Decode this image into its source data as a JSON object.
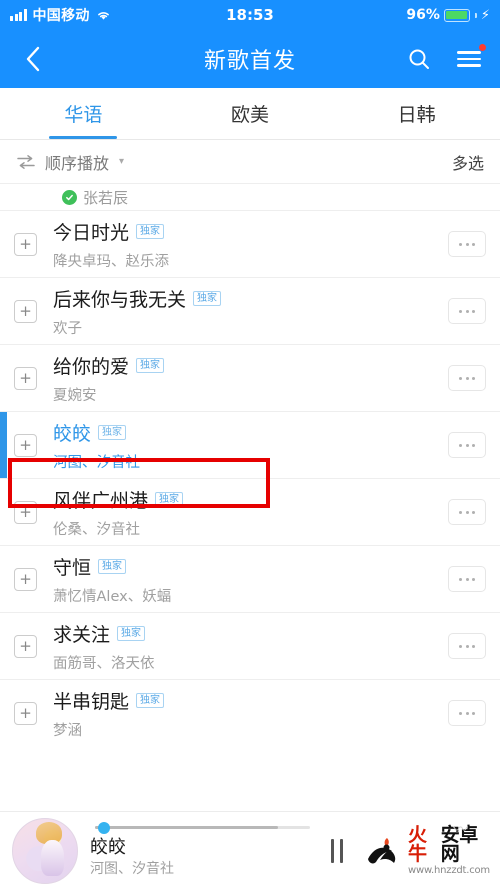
{
  "status_bar": {
    "carrier": "中国移动",
    "time": "18:53",
    "battery_percent": "96%",
    "battery_level": 96,
    "charging_icon": "⚡",
    "signal_icon": "signal-bars-icon",
    "wifi_icon": "wifi-icon"
  },
  "header": {
    "title": "新歌首发",
    "back_icon": "back-chevron-icon",
    "search_icon": "search-icon",
    "menu_icon": "hamburger-menu-icon",
    "notification_dot": true,
    "background_color": "#1890ff"
  },
  "tabs": [
    {
      "label": "华语",
      "active": true
    },
    {
      "label": "欧美",
      "active": false
    },
    {
      "label": "日韩",
      "active": false
    }
  ],
  "control_row": {
    "play_mode_icon": "sequential-play-icon",
    "play_mode_label": "顺序播放",
    "chevron_icon": "chevron-down-icon",
    "multi_select_label": "多选"
  },
  "partial_row": {
    "verified_icon": "verified-badge-icon",
    "artist": "张若辰"
  },
  "songs": [
    {
      "title": "今日时光",
      "badge": "独家",
      "artist": "降央卓玛、赵乐添",
      "playing": false,
      "add_icon": "plus-icon",
      "more_icon": "more-dots-icon"
    },
    {
      "title": "后来你与我无关",
      "badge": "独家",
      "artist": "欢子",
      "playing": false,
      "add_icon": "plus-icon",
      "more_icon": "more-dots-icon"
    },
    {
      "title": "给你的爱",
      "badge": "独家",
      "artist": "夏婉安",
      "playing": false,
      "add_icon": "plus-icon",
      "more_icon": "more-dots-icon"
    },
    {
      "title": "皎皎",
      "badge": "独家",
      "artist": "河图、汐音社",
      "playing": true,
      "add_icon": "plus-icon",
      "more_icon": "more-dots-icon"
    },
    {
      "title": "风伴广州港",
      "badge": "独家",
      "artist": "伦桑、汐音社",
      "playing": false,
      "add_icon": "plus-icon",
      "more_icon": "more-dots-icon"
    },
    {
      "title": "守恒",
      "badge": "独家",
      "artist": "萧忆情Alex、妖蝠",
      "playing": false,
      "add_icon": "plus-icon",
      "more_icon": "more-dots-icon"
    },
    {
      "title": "求关注",
      "badge": "独家",
      "artist": "面筋哥、洛天依",
      "playing": false,
      "add_icon": "plus-icon",
      "more_icon": "more-dots-icon"
    },
    {
      "title": "半串钥匙",
      "badge": "独家",
      "artist": "梦涵",
      "playing": false,
      "add_icon": "plus-icon",
      "more_icon": "more-dots-icon"
    }
  ],
  "player": {
    "album_art_icon": "album-art-thumbnail",
    "now_playing_title": "皎皎",
    "now_playing_artist": "河图、汐音社",
    "progress_percent": 4,
    "pause_icon": "pause-icon"
  },
  "watermark": {
    "brand_red": "火牛",
    "brand_dark": "安卓网",
    "url": "www.hnzzdt.com",
    "logo_icon": "huoniu-logo-icon"
  },
  "annotation": {
    "type": "red-rectangle-highlight",
    "color": "#e60000",
    "targets_song": "皎皎"
  }
}
